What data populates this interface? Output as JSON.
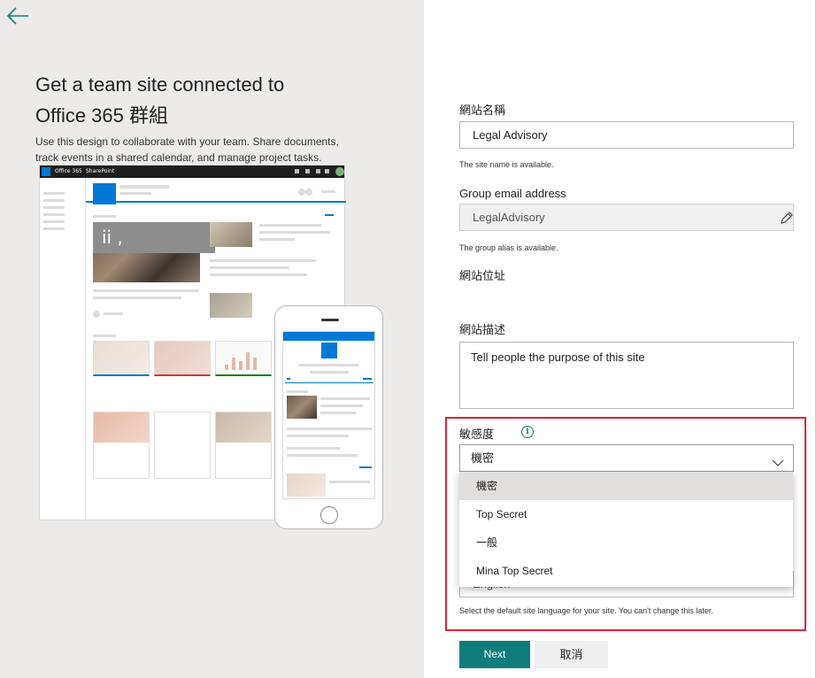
{
  "left_panel": {
    "title_line1": "Get a team site connected to",
    "title_line2": "Office 365 群組",
    "description": "Use this design to collaborate with your team. Share documents, track events in a shared calendar, and manage project tasks.",
    "mockup": {
      "topbar_brand": "Office 365",
      "topbar_app": "SharePoint",
      "overlay_text": "ii ,"
    }
  },
  "form": {
    "site_name": {
      "label": "網站名稱",
      "value": "Legal Advisory",
      "hint": "The site name is available."
    },
    "group_email": {
      "label": "Group email address",
      "value": "LegalAdvisory",
      "hint": "The group alias is available."
    },
    "site_address": {
      "label": "網站位址"
    },
    "site_description": {
      "label": "網站描述",
      "placeholder": "Tell people the purpose of this site"
    },
    "sensitivity": {
      "label": "敏感度",
      "selected": "機密",
      "options": [
        "機密",
        "Top Secret",
        "一般",
        "Mina Top Secret"
      ]
    },
    "language": {
      "value": "English",
      "hint": "Select the default site language for your site. You can't change this later."
    }
  },
  "buttons": {
    "next": "Next",
    "cancel": "取消"
  },
  "colors": {
    "accent": "#0f7c7c",
    "highlight": "#d7263d",
    "left_bg": "#ecebe9",
    "sharepoint_blue": "#0078d4"
  }
}
